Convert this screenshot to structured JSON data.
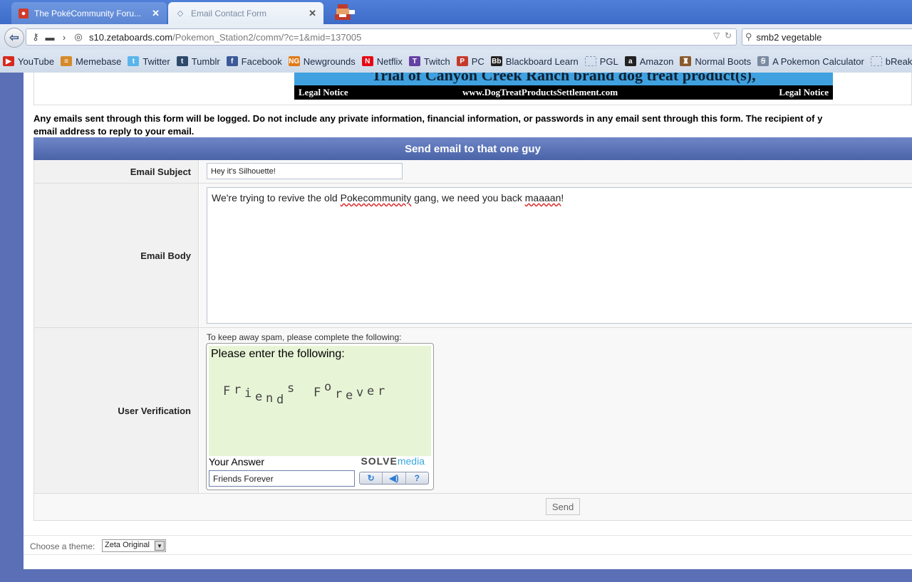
{
  "browser": {
    "tabs": [
      {
        "title": "The PokéCommunity Foru...",
        "active": false,
        "icon": "pokecommunity-icon"
      },
      {
        "title": "Email Contact Form",
        "active": true,
        "icon": "zetaboards-icon"
      }
    ],
    "url": {
      "host": "s10.zetaboards.com",
      "path": "/Pokemon_Station2/comm/?c=1&mid=137005"
    },
    "search": "smb2 vegetable",
    "bookmarks": [
      {
        "label": "YouTube",
        "icon": "youtube-icon",
        "color": "#d6291f",
        "glyph": "▶"
      },
      {
        "label": "Memebase",
        "icon": "memebase-icon",
        "color": "#d58a2a",
        "glyph": "≡"
      },
      {
        "label": "Twitter",
        "icon": "twitter-icon",
        "color": "#5ab5ea",
        "glyph": "t"
      },
      {
        "label": "Tumblr",
        "icon": "tumblr-icon",
        "color": "#2d4a6b",
        "glyph": "t"
      },
      {
        "label": "Facebook",
        "icon": "facebook-icon",
        "color": "#3b5998",
        "glyph": "f"
      },
      {
        "label": "Newgrounds",
        "icon": "newgrounds-icon",
        "color": "#e07a17",
        "glyph": "NG"
      },
      {
        "label": "Netflix",
        "icon": "netflix-icon",
        "color": "#e50914",
        "glyph": "N"
      },
      {
        "label": "Twitch",
        "icon": "twitch-icon",
        "color": "#6441a4",
        "glyph": "T"
      },
      {
        "label": "PC",
        "icon": "pc-icon",
        "color": "#c43b2e",
        "glyph": "P"
      },
      {
        "label": "Blackboard Learn",
        "icon": "blackboard-icon",
        "color": "#222222",
        "glyph": "Bb"
      },
      {
        "label": "PGL",
        "icon": "pgl-icon",
        "color": "#c7d1e0",
        "glyph": ""
      },
      {
        "label": "Amazon",
        "icon": "amazon-icon",
        "color": "#222222",
        "glyph": "a"
      },
      {
        "label": "Normal Boots",
        "icon": "normal-boots-icon",
        "color": "#8a5a2c",
        "glyph": "♜"
      },
      {
        "label": "A Pokemon Calculator",
        "icon": "calculator-icon",
        "color": "#7a8aa0",
        "glyph": "Ꞩ"
      },
      {
        "label": "bReakMyTeam",
        "icon": "breakmyteam-icon",
        "color": "#c7d1e0",
        "glyph": ""
      }
    ]
  },
  "banner": {
    "headline": "Trial of Canyon Creek Ranch brand dog treat product(s),",
    "left": "Legal Notice",
    "center": "www.DogTreatProductsSettlement.com",
    "right": "Legal Notice"
  },
  "notice": {
    "line1": "Any emails sent through this form will be logged. Do not include any private information, financial information, or passwords in any email sent through this form. The recipient of y",
    "line2": "email address to reply to your email."
  },
  "form": {
    "title": "Send email to that one guy",
    "subject_label": "Email Subject",
    "subject_value": "Hey it's Silhouette!",
    "body_label": "Email Body",
    "body_parts": [
      "We're trying to revive the old ",
      "Pokecommunity",
      " gang, we need you back ",
      "maaaan",
      "!"
    ],
    "verify_label": "User Verification",
    "captcha_note": "To keep away spam, please complete the following:",
    "captcha_prompt": "Please enter the following:",
    "captcha_text": "Friends Forever",
    "your_answer_label": "Your Answer",
    "answer_value": "Friends Forever",
    "solve_a": "SOLVE",
    "solve_b": "media",
    "controls": [
      {
        "icon": "refresh-icon",
        "glyph": "↻"
      },
      {
        "icon": "audio-icon",
        "glyph": "◀)"
      },
      {
        "icon": "help-icon",
        "glyph": "?"
      }
    ],
    "send_label": "Send"
  },
  "footer": {
    "theme_label": "Choose a theme:",
    "theme_value": "Zeta Original"
  }
}
